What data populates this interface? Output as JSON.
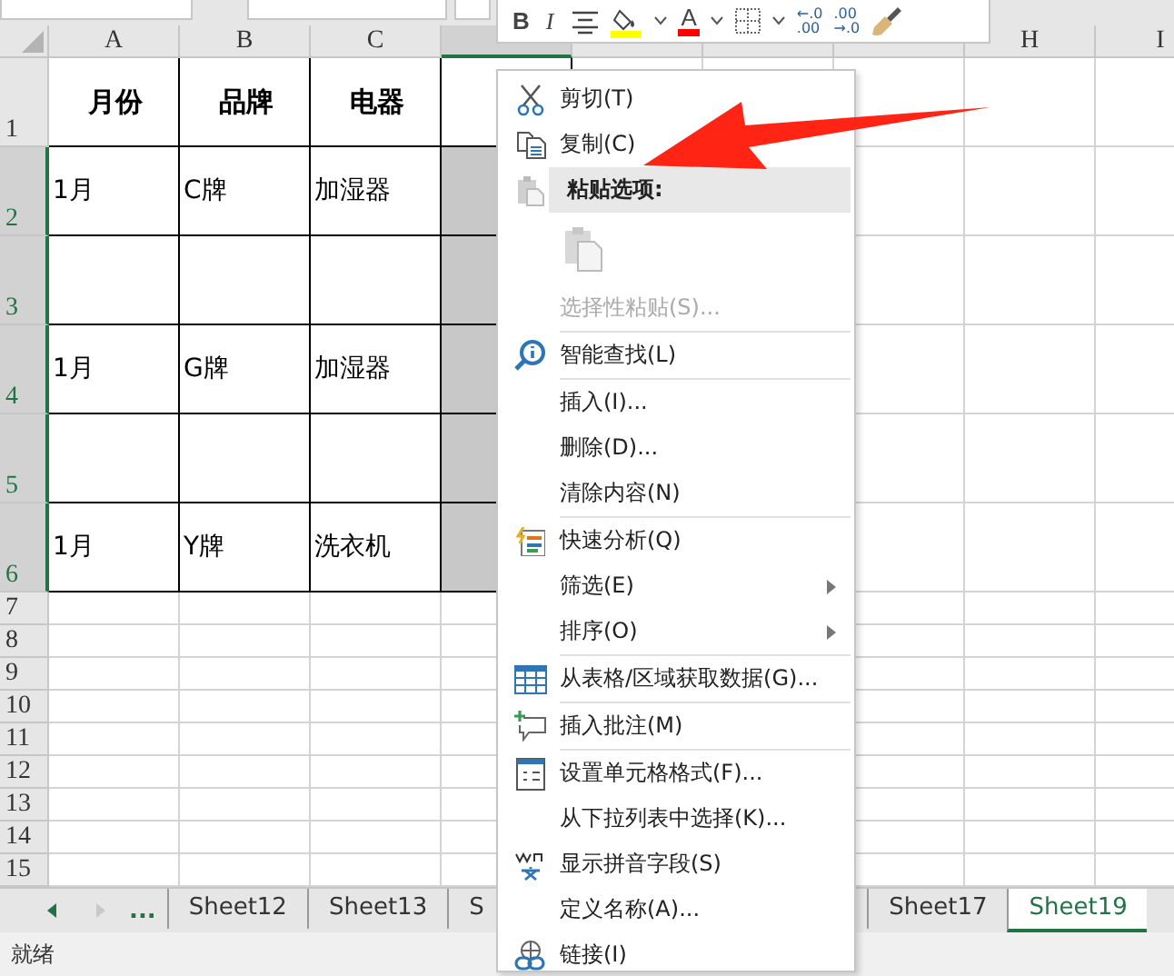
{
  "columns": [
    {
      "label": "A",
      "selected": false
    },
    {
      "label": "B",
      "selected": false
    },
    {
      "label": "C",
      "selected": false
    },
    {
      "selected": true
    },
    {
      "selected": false
    },
    {
      "selected": false
    },
    {
      "selected": false
    },
    {
      "label": "H",
      "selected": false
    },
    {
      "label": "I",
      "selected": false
    }
  ],
  "rows": [
    {
      "number": "1",
      "kind": "table-header",
      "selected": false,
      "cells": [
        "月份",
        "品牌",
        "电器"
      ]
    },
    {
      "number": "2",
      "kind": "table-row",
      "selected": true,
      "cells": [
        "1月",
        "C牌",
        "加湿器"
      ]
    },
    {
      "number": "3",
      "kind": "table-row",
      "selected": true
    },
    {
      "number": "4",
      "kind": "table-row",
      "selected": true,
      "cells": [
        "1月",
        "G牌",
        "加湿器"
      ]
    },
    {
      "number": "5",
      "kind": "table-row",
      "selected": true
    },
    {
      "number": "6",
      "kind": "table-row",
      "selected": true,
      "cells": [
        "1月",
        "Y牌",
        "洗衣机"
      ]
    },
    {
      "number": "7",
      "kind": "blank",
      "selected": false
    },
    {
      "number": "8",
      "kind": "blank",
      "selected": false
    },
    {
      "number": "9",
      "kind": "blank",
      "selected": false
    },
    {
      "number": "10",
      "kind": "blank",
      "selected": false
    },
    {
      "number": "11",
      "kind": "blank",
      "selected": false
    },
    {
      "number": "12",
      "kind": "blank",
      "selected": false
    },
    {
      "number": "13",
      "kind": "blank",
      "selected": false
    },
    {
      "number": "14",
      "kind": "blank",
      "selected": false
    },
    {
      "number": "15",
      "kind": "blank",
      "selected": false
    }
  ],
  "mini_toolbar": [
    {
      "kind": "bold",
      "label": "B"
    },
    {
      "kind": "italic",
      "label": "I"
    },
    {
      "kind": "align"
    },
    {
      "kind": "fill-color"
    },
    {
      "kind": "dropdown"
    },
    {
      "kind": "font-color",
      "label": "A"
    },
    {
      "kind": "dropdown"
    },
    {
      "kind": "borders"
    },
    {
      "kind": "dropdown"
    },
    {
      "kind": "decimal",
      "top": "←.0",
      "bottom": ".00"
    },
    {
      "kind": "decimal",
      "top": ".00",
      "bottom": "→.0"
    },
    {
      "kind": "format-painter"
    }
  ],
  "context_menu": [
    {
      "kind": "item",
      "label": "剪切(T)",
      "disabled": false,
      "submenu": false
    },
    {
      "kind": "item",
      "label": "复制(C)",
      "disabled": false,
      "submenu": false
    },
    {
      "kind": "heading",
      "label": "粘贴选项:"
    },
    {
      "kind": "paste-options"
    },
    {
      "kind": "item",
      "label": "选择性粘贴(S)...",
      "disabled": true,
      "submenu": false
    },
    {
      "kind": "separator"
    },
    {
      "kind": "item",
      "label": "智能查找(L)",
      "disabled": false,
      "submenu": false
    },
    {
      "kind": "separator"
    },
    {
      "kind": "item",
      "label": "插入(I)...",
      "disabled": false,
      "submenu": false
    },
    {
      "kind": "item",
      "label": "删除(D)...",
      "disabled": false,
      "submenu": false
    },
    {
      "kind": "item",
      "label": "清除内容(N)",
      "disabled": false,
      "submenu": false
    },
    {
      "kind": "separator"
    },
    {
      "kind": "item",
      "label": "快速分析(Q)",
      "disabled": false,
      "submenu": false
    },
    {
      "kind": "item",
      "label": "筛选(E)",
      "disabled": false,
      "submenu": true
    },
    {
      "kind": "item",
      "label": "排序(O)",
      "disabled": false,
      "submenu": true
    },
    {
      "kind": "separator"
    },
    {
      "kind": "item",
      "label": "从表格/区域获取数据(G)...",
      "disabled": false,
      "submenu": false
    },
    {
      "kind": "separator"
    },
    {
      "kind": "item",
      "label": "插入批注(M)",
      "disabled": false,
      "submenu": false
    },
    {
      "kind": "separator"
    },
    {
      "kind": "item",
      "label": "设置单元格格式(F)...",
      "disabled": false,
      "submenu": false
    },
    {
      "kind": "item",
      "label": "从下拉列表中选择(K)...",
      "disabled": false,
      "submenu": false
    },
    {
      "kind": "item",
      "label": "显示拼音字段(S)",
      "disabled": false,
      "submenu": false
    },
    {
      "kind": "item",
      "label": "定义名称(A)...",
      "disabled": false,
      "submenu": false
    },
    {
      "kind": "item",
      "label": "链接(I)",
      "disabled": false,
      "submenu": false
    }
  ],
  "sheet_tabs": {
    "more": "...",
    "tabs": [
      {
        "label": "Sheet12",
        "selected": false,
        "truncated": false
      },
      {
        "label": "Sheet13",
        "selected": false,
        "truncated": false
      },
      {
        "label": "S",
        "selected": false,
        "truncated": true
      },
      {
        "label": "Sheet17",
        "selected": false,
        "truncated": false
      },
      {
        "label": "Sheet19",
        "selected": true,
        "truncated": false
      }
    ]
  },
  "status_bar": {
    "text": "就绪"
  }
}
